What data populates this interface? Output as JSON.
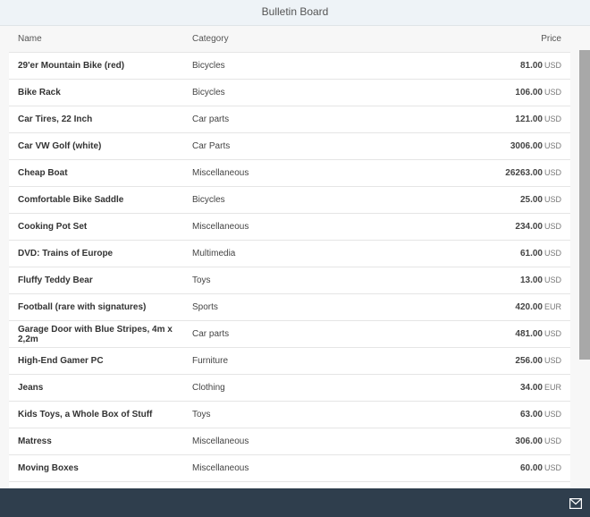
{
  "header": {
    "title": "Bulletin Board"
  },
  "table": {
    "columns": {
      "name": "Name",
      "category": "Category",
      "price": "Price"
    },
    "rows": [
      {
        "name": "29'er Mountain Bike (red)",
        "category": "Bicycles",
        "price": "81.00",
        "currency": "USD"
      },
      {
        "name": "Bike Rack",
        "category": "Bicycles",
        "price": "106.00",
        "currency": "USD"
      },
      {
        "name": "Car Tires, 22 Inch",
        "category": "Car parts",
        "price": "121.00",
        "currency": "USD"
      },
      {
        "name": "Car VW Golf (white)",
        "category": "Car Parts",
        "price": "3006.00",
        "currency": "USD"
      },
      {
        "name": "Cheap Boat",
        "category": "Miscellaneous",
        "price": "26263.00",
        "currency": "USD"
      },
      {
        "name": "Comfortable Bike Saddle",
        "category": "Bicycles",
        "price": "25.00",
        "currency": "USD"
      },
      {
        "name": "Cooking Pot Set",
        "category": "Miscellaneous",
        "price": "234.00",
        "currency": "USD"
      },
      {
        "name": "DVD: Trains of Europe",
        "category": "Multimedia",
        "price": "61.00",
        "currency": "USD"
      },
      {
        "name": "Fluffy Teddy Bear",
        "category": "Toys",
        "price": "13.00",
        "currency": "USD"
      },
      {
        "name": "Football (rare with signatures)",
        "category": "Sports",
        "price": "420.00",
        "currency": "EUR"
      },
      {
        "name": "Garage Door with Blue Stripes, 4m x 2,2m",
        "category": "Car parts",
        "price": "481.00",
        "currency": "USD"
      },
      {
        "name": "High-End Gamer PC",
        "category": "Furniture",
        "price": "256.00",
        "currency": "USD"
      },
      {
        "name": "Jeans",
        "category": "Clothing",
        "price": "34.00",
        "currency": "EUR"
      },
      {
        "name": "Kids Toys, a Whole Box of Stuff",
        "category": "Toys",
        "price": "63.00",
        "currency": "USD"
      },
      {
        "name": "Matress",
        "category": "Miscellaneous",
        "price": "306.00",
        "currency": "USD"
      },
      {
        "name": "Moving Boxes",
        "category": "Miscellaneous",
        "price": "60.00",
        "currency": "USD"
      }
    ]
  },
  "footer": {
    "icon": "mail-icon"
  },
  "colors": {
    "footer_bg": "#2f3e4d",
    "title_bg": "#eef3f7",
    "scrollbar": "#a8a8a8"
  }
}
